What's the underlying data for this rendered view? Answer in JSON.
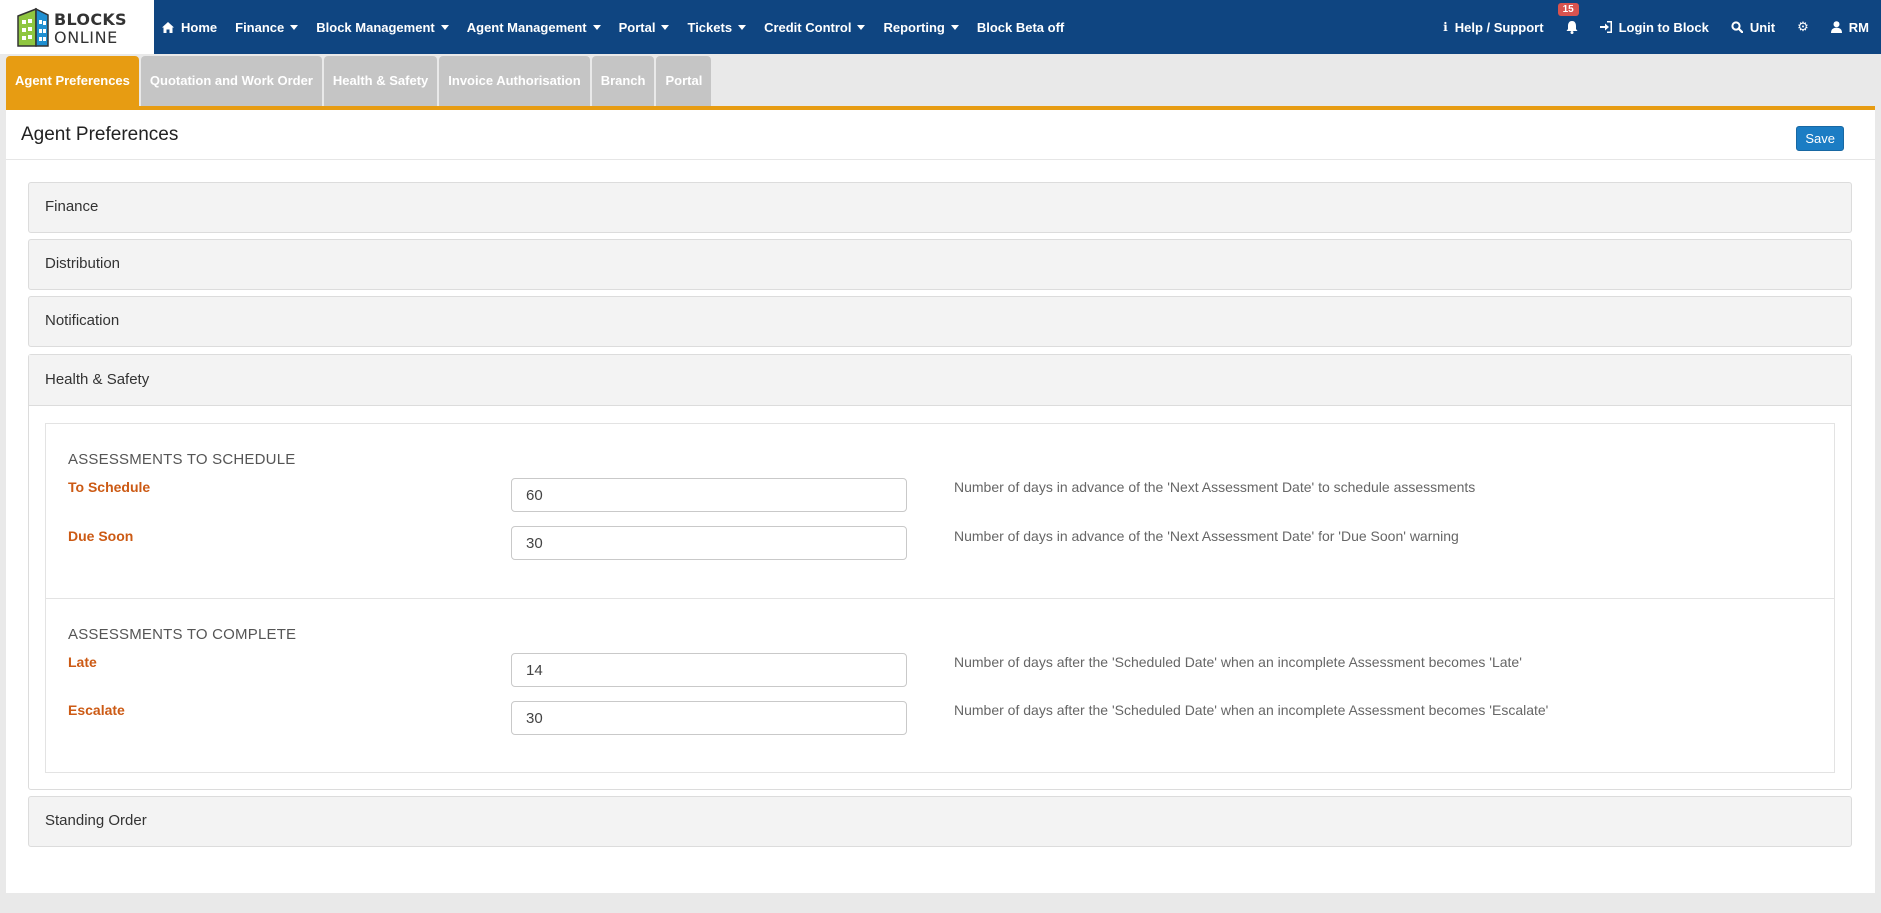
{
  "brand": {
    "line1": "BLOCKS",
    "line2": "ONLINE"
  },
  "nav": {
    "home": "Home",
    "finance": "Finance",
    "block_management": "Block Management",
    "agent_management": "Agent Management",
    "portal": "Portal",
    "tickets": "Tickets",
    "credit_control": "Credit Control",
    "reporting": "Reporting",
    "block_beta": "Block Beta off",
    "help": "Help / Support",
    "notification_count": "15",
    "login_block": "Login to Block",
    "unit": "Unit",
    "user": "RM"
  },
  "tabs": [
    {
      "label": "Agent Preferences",
      "active": true
    },
    {
      "label": "Quotation and Work Order"
    },
    {
      "label": "Health & Safety"
    },
    {
      "label": "Invoice Authorisation"
    },
    {
      "label": "Branch"
    },
    {
      "label": "Portal"
    }
  ],
  "page": {
    "title": "Agent Preferences",
    "save_label": "Save"
  },
  "sections": {
    "finance": "Finance",
    "distribution": "Distribution",
    "notification": "Notification",
    "health_safety": "Health & Safety",
    "standing_order": "Standing Order"
  },
  "health_safety": {
    "schedule": {
      "title": "ASSESSMENTS TO SCHEDULE",
      "to_schedule": {
        "label": "To Schedule",
        "value": "60",
        "help": "Number of days in advance of the 'Next Assessment Date' to schedule assessments"
      },
      "due_soon": {
        "label": "Due Soon",
        "value": "30",
        "help": "Number of days in advance of the 'Next Assessment Date' for 'Due Soon' warning"
      }
    },
    "complete": {
      "title": "ASSESSMENTS TO COMPLETE",
      "late": {
        "label": "Late",
        "value": "14",
        "help": "Number of days after the 'Scheduled Date' when an incomplete Assessment becomes 'Late'"
      },
      "escalate": {
        "label": "Escalate",
        "value": "30",
        "help": "Number of days after the 'Scheduled Date' when an incomplete Assessment becomes 'Escalate'"
      }
    }
  },
  "colors": {
    "navbar": "#0f4581",
    "active_tab": "#e79c12",
    "label": "#cc5a14",
    "save": "#1b7dc4"
  }
}
